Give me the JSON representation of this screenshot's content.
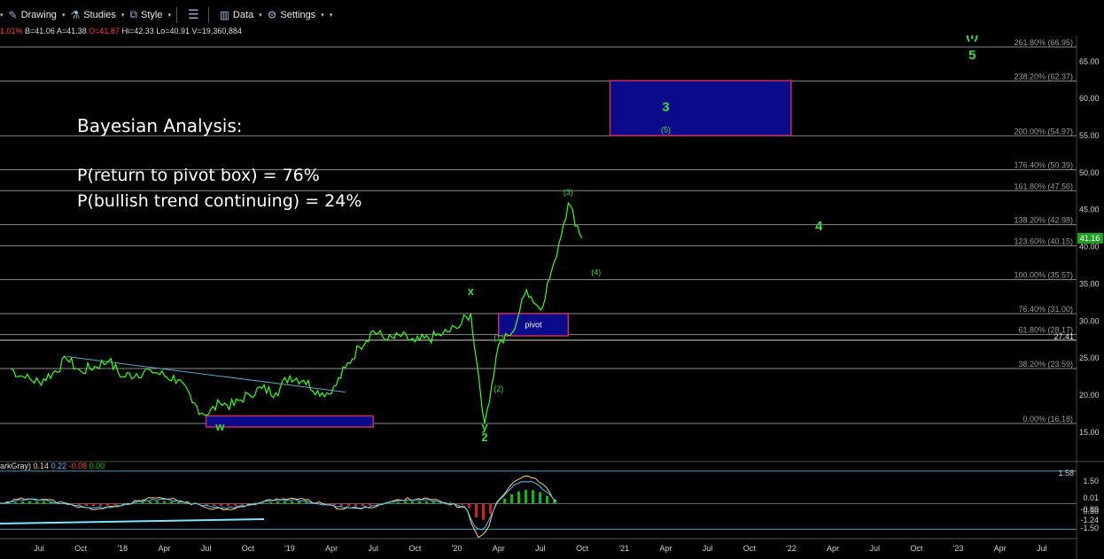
{
  "toolbar": {
    "items": [
      {
        "label": "Drawing",
        "icon": "pencil-icon"
      },
      {
        "label": "Studies",
        "icon": "flask-icon"
      },
      {
        "label": "Style",
        "icon": "style-icon"
      },
      {
        "label": "",
        "icon": "panels-icon"
      },
      {
        "label": "Data",
        "icon": "bar-chart-icon"
      },
      {
        "label": "Settings",
        "icon": "gear-icon"
      }
    ]
  },
  "quote": {
    "change": "1.01%",
    "bid": "B=41.06",
    "ask": "A=41.38",
    "open": "O=41.87",
    "high": "Hi=42.33",
    "low": "Lo=40.91",
    "volume": "V=19,360,884"
  },
  "annotation": {
    "title": "Bayesian Analysis:",
    "line1": "P(return to pivot box) = 76%",
    "line2": "P(bullish trend continuing) = 24%"
  },
  "indicator": {
    "name": "arkGray)",
    "values": [
      "0.14",
      "0.22",
      "-0.08",
      "0.00"
    ],
    "colors": [
      "#ffd070",
      "#4fc3f7",
      "#ff4040",
      "#00d000"
    ],
    "axis_labels": [
      "1.58",
      "1.50",
      "0.01",
      "0.50",
      "-0.89",
      "-1.24",
      "-1.50"
    ]
  },
  "colors": {
    "price": "#39ff14",
    "fib": "#8a8a8a",
    "box": "#0a0a8a",
    "box_border": "#c0305a",
    "wave": "#39d939",
    "last_price_bg": "#21a121"
  },
  "chart_data": {
    "type": "line",
    "xlabel": "",
    "ylabel": "",
    "x_ticks": [
      "Jul",
      "Oct",
      "'18",
      "Apr",
      "Jul",
      "Oct",
      "'19",
      "Apr",
      "Jul",
      "Oct",
      "'20",
      "Apr",
      "Jul",
      "Oct",
      "'21",
      "Apr",
      "Jul",
      "Oct",
      "'22",
      "Apr",
      "Jul",
      "Oct",
      "'23",
      "Apr",
      "Jul"
    ],
    "y_ticks": [
      15.0,
      20.0,
      25.0,
      30.0,
      35.0,
      40.0,
      45.0,
      50.0,
      55.0,
      60.0,
      65.0
    ],
    "ylim": [
      12.0,
      68.5
    ],
    "last_price": "41.16",
    "fib_levels": [
      {
        "label": "261.80% (66.95)",
        "value": 66.95
      },
      {
        "label": "238.20% (62.37)",
        "value": 62.37
      },
      {
        "label": "200.00% (54.97)",
        "value": 54.97
      },
      {
        "label": "176.40% (50.39)",
        "value": 50.39
      },
      {
        "label": "161.80% (47.56)",
        "value": 47.56
      },
      {
        "label": "138.20% (42.98)",
        "value": 42.98
      },
      {
        "label": "123.60% (40.15)",
        "value": 40.15
      },
      {
        "label": "100.00% (35.57)",
        "value": 35.57
      },
      {
        "label": "76.40% (31.00)",
        "value": 31.0
      },
      {
        "label": "61.80% (28.17)",
        "value": 28.17
      },
      {
        "label": "38.20% (23.59)",
        "value": 23.59
      },
      {
        "label": "0.00% (16.18)",
        "value": 16.18
      }
    ],
    "extra_level": {
      "label": "27.41",
      "value": 27.41
    },
    "series": [
      {
        "name": "",
        "points": [
          [
            "2017-05",
            23.5
          ],
          [
            "2017-06",
            22.3
          ],
          [
            "2017-07",
            21.8
          ],
          [
            "2017-08",
            23.0
          ],
          [
            "2017-09",
            24.8
          ],
          [
            "2017-10",
            23.2
          ],
          [
            "2017-11",
            23.9
          ],
          [
            "2017-12",
            24.6
          ],
          [
            "2018-01",
            22.5
          ],
          [
            "2018-02",
            22.9
          ],
          [
            "2018-03",
            23.4
          ],
          [
            "2018-04",
            22.6
          ],
          [
            "2018-05",
            22.1
          ],
          [
            "2018-06",
            19.0
          ],
          [
            "2018-07",
            17.3
          ],
          [
            "2018-08",
            18.9
          ],
          [
            "2018-09",
            18.6
          ],
          [
            "2018-10",
            20.2
          ],
          [
            "2018-11",
            20.9
          ],
          [
            "2018-12",
            20.3
          ],
          [
            "2019-01",
            22.6
          ],
          [
            "2019-02",
            22.0
          ],
          [
            "2019-03",
            20.6
          ],
          [
            "2019-04",
            20.2
          ],
          [
            "2019-05",
            23.7
          ],
          [
            "2019-06",
            26.5
          ],
          [
            "2019-07",
            28.7
          ],
          [
            "2019-08",
            27.4
          ],
          [
            "2019-09",
            27.9
          ],
          [
            "2019-10",
            27.2
          ],
          [
            "2019-11",
            27.6
          ],
          [
            "2019-12",
            28.3
          ],
          [
            "2020-01",
            29.0
          ],
          [
            "2020-02",
            31.0
          ],
          [
            "2020-03",
            16.2
          ],
          [
            "2020-04",
            26.8
          ],
          [
            "2020-05",
            28.5
          ],
          [
            "2020-06",
            34.2
          ],
          [
            "2020-07",
            31.5
          ],
          [
            "2020-08",
            38.0
          ],
          [
            "2020-09",
            45.9
          ],
          [
            "2020-10",
            41.2
          ]
        ]
      }
    ],
    "boxes": [
      {
        "label": "pivot",
        "x_range": [
          "2020-04",
          "2020-09"
        ],
        "y_range": [
          28.0,
          31.0
        ]
      },
      {
        "label": "",
        "x_range": [
          "2018-07",
          "2019-07"
        ],
        "y_range": [
          15.7,
          17.2
        ]
      },
      {
        "label": "",
        "x_range": [
          "2020-12",
          "2022-01"
        ],
        "y_range": [
          55.0,
          62.4
        ]
      }
    ],
    "trendline": {
      "from": [
        "2017-09",
        25.2
      ],
      "to": [
        "2019-05",
        20.4
      ]
    },
    "wave_labels": [
      {
        "text": "w",
        "x": "2018-08",
        "y": 15.2,
        "size": "small"
      },
      {
        "text": "x",
        "x": "2020-02",
        "y": 33.5,
        "size": "small"
      },
      {
        "text": "y",
        "x": "2020-03",
        "y": 15.2,
        "size": "small"
      },
      {
        "text": "2",
        "x": "2020-03",
        "y": 13.8,
        "size": "small"
      },
      {
        "text": "(1)",
        "x": "2020-04",
        "y": 27.4,
        "size": "tiny"
      },
      {
        "text": "(2)",
        "x": "2020-04",
        "y": 20.5,
        "size": "tiny"
      },
      {
        "text": "(3)",
        "x": "2020-09",
        "y": 47.0,
        "size": "tiny"
      },
      {
        "text": "(4)",
        "x": "2020-11",
        "y": 36.2,
        "size": "tiny"
      },
      {
        "text": "3",
        "x": "2021-04",
        "y": 58.3,
        "size": "big"
      },
      {
        "text": "(5)",
        "x": "2021-04",
        "y": 55.4,
        "size": "tiny"
      },
      {
        "text": "4",
        "x": "2022-03",
        "y": 42.2,
        "size": "big"
      },
      {
        "text": "(i)",
        "x": "2023-02",
        "y": 68.0,
        "size": "big"
      },
      {
        "text": "5",
        "x": "2023-02",
        "y": 65.3,
        "size": "big"
      }
    ]
  }
}
